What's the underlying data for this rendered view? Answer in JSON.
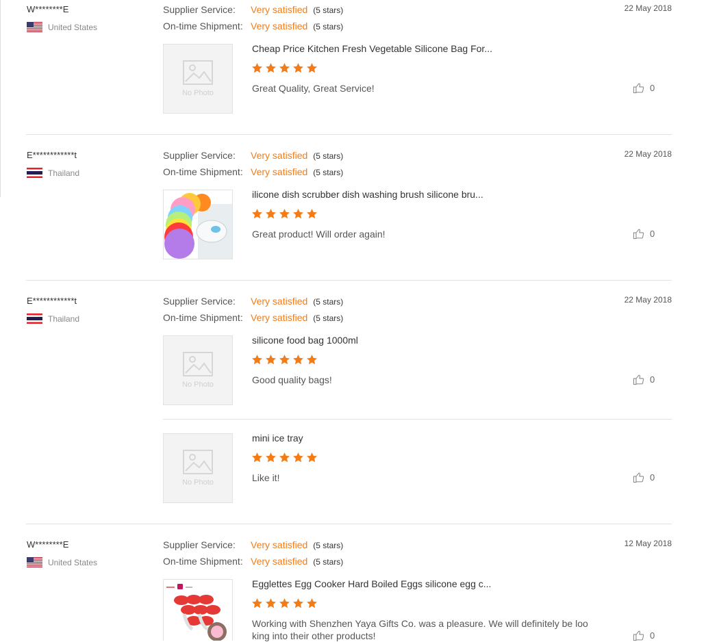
{
  "labels": {
    "supplier_service": "Supplier Service:",
    "ontime_shipment": "On-time Shipment:",
    "no_photo": "No Photo"
  },
  "colors": {
    "accent_orange": "#f27c18",
    "separator": "#e1e1e1"
  },
  "reviews": [
    {
      "buyer": "W********E",
      "country": "United States",
      "flag_icon": "us-flag-icon",
      "supplier_service": {
        "value": "Very satisfied",
        "stars": "(5 stars)"
      },
      "ontime_shipment": {
        "value": "Very satisfied",
        "stars": "(5 stars)"
      },
      "date": "22 May 2018",
      "items": [
        {
          "title": "Cheap Price Kitchen Fresh Vegetable Silicone Bag For...",
          "rating": 5,
          "comment": "Great Quality, Great Service!",
          "likes": "0",
          "photo": "no-photo"
        }
      ]
    },
    {
      "buyer": "E************t",
      "country": "Thailand",
      "flag_icon": "thailand-flag-icon",
      "supplier_service": {
        "value": "Very satisfied",
        "stars": "(5 stars)"
      },
      "ontime_shipment": {
        "value": "Very satisfied",
        "stars": "(5 stars)"
      },
      "date": "22 May 2018",
      "items": [
        {
          "title": "ilicone dish scrubber dish washing brush silicone bru...",
          "rating": 5,
          "comment": "Great product! Will order again!",
          "likes": "0",
          "photo": "silicone-scrubbers-photo"
        }
      ]
    },
    {
      "buyer": "E************t",
      "country": "Thailand",
      "flag_icon": "thailand-flag-icon",
      "supplier_service": {
        "value": "Very satisfied",
        "stars": "(5 stars)"
      },
      "ontime_shipment": {
        "value": "Very satisfied",
        "stars": "(5 stars)"
      },
      "date": "22 May 2018",
      "items": [
        {
          "title": "silicone food bag 1000ml",
          "rating": 5,
          "comment": "Good quality bags!",
          "likes": "0",
          "photo": "no-photo"
        },
        {
          "title": "mini ice tray",
          "rating": 5,
          "comment": "Like it!",
          "likes": "0",
          "photo": "no-photo"
        }
      ]
    },
    {
      "buyer": "W********E",
      "country": "United States",
      "flag_icon": "us-flag-icon",
      "supplier_service": {
        "value": "Very satisfied",
        "stars": "(5 stars)"
      },
      "ontime_shipment": {
        "value": "Very satisfied",
        "stars": "(5 stars)"
      },
      "date": "12 May 2018",
      "items": [
        {
          "title": "Egglettes Egg Cooker Hard Boiled Eggs silicone egg c...",
          "rating": 5,
          "comment": "Working with Shenzhen Yaya Gifts Co. was a pleasure. We will definitely be loo king into their other products!",
          "likes": "0",
          "photo": "egg-cooker-photo"
        }
      ]
    }
  ]
}
